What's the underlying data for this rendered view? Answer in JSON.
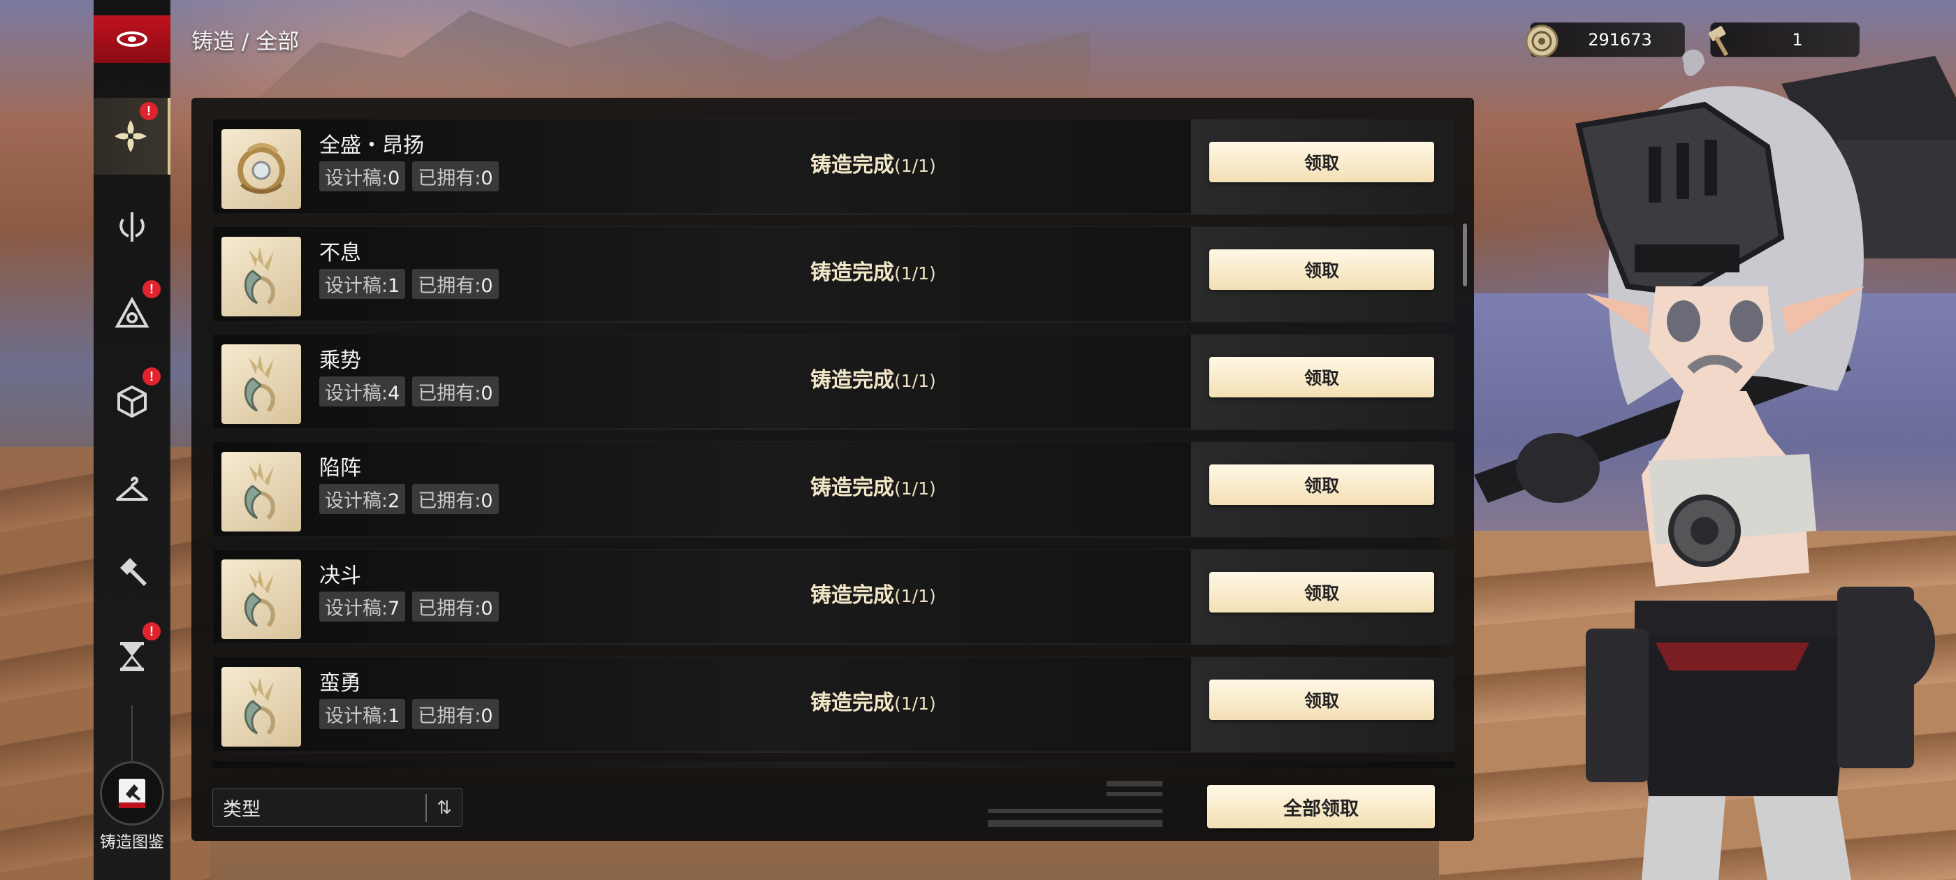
{
  "breadcrumb": "铸造 / 全部",
  "currencies": [
    {
      "icon": "coin-icon",
      "value": "291673"
    },
    {
      "icon": "hammer-icon",
      "value": "1"
    }
  ],
  "sidebar": {
    "items": [
      {
        "icon": "flower-icon",
        "active": true,
        "badge": "!"
      },
      {
        "icon": "sword-emblem-icon",
        "active": false,
        "badge": ""
      },
      {
        "icon": "triad-icon",
        "active": false,
        "badge": "!"
      },
      {
        "icon": "cube-icon",
        "active": false,
        "badge": "!"
      },
      {
        "icon": "hanger-icon",
        "active": false,
        "badge": ""
      },
      {
        "icon": "forge-hammer-icon",
        "active": false,
        "badge": ""
      },
      {
        "icon": "hourglass-icon",
        "active": false,
        "badge": "!"
      }
    ],
    "codex_label": "铸造图鉴"
  },
  "labels": {
    "design": "设计稿:",
    "owned": "已拥有:",
    "status": "铸造完成",
    "claim": "领取"
  },
  "items": [
    {
      "name": "全盛・昂扬",
      "design": "0",
      "owned": "0",
      "status": "铸造完成",
      "count": "(1/1)",
      "claim": "领取",
      "thumb": "round-emblem"
    },
    {
      "name": "不息",
      "design": "1",
      "owned": "0",
      "status": "铸造完成",
      "count": "(1/1)",
      "claim": "领取",
      "thumb": "spiky-crest"
    },
    {
      "name": "乘势",
      "design": "4",
      "owned": "0",
      "status": "铸造完成",
      "count": "(1/1)",
      "claim": "领取",
      "thumb": "spiky-crest"
    },
    {
      "name": "陷阵",
      "design": "2",
      "owned": "0",
      "status": "铸造完成",
      "count": "(1/1)",
      "claim": "领取",
      "thumb": "spiky-crest"
    },
    {
      "name": "决斗",
      "design": "7",
      "owned": "0",
      "status": "铸造完成",
      "count": "(1/1)",
      "claim": "领取",
      "thumb": "spiky-crest"
    },
    {
      "name": "蛮勇",
      "design": "1",
      "owned": "0",
      "status": "铸造完成",
      "count": "(1/1)",
      "claim": "领取",
      "thumb": "spiky-crest"
    }
  ],
  "footer": {
    "type_label": "类型",
    "sort_icon": "sort-icon",
    "claim_all": "全部领取"
  }
}
